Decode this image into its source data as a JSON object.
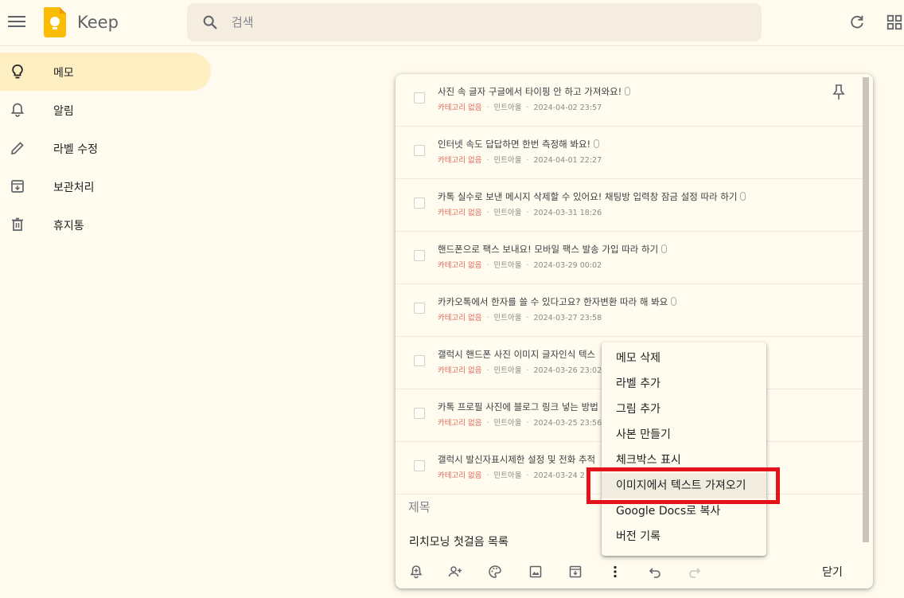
{
  "header": {
    "app_title": "Keep",
    "search_placeholder": "검색"
  },
  "sidebar": {
    "items": [
      {
        "label": "메모",
        "icon": "lightbulb-icon",
        "active": true
      },
      {
        "label": "알림",
        "icon": "bell-icon",
        "active": false
      },
      {
        "label": "라벨 수정",
        "icon": "pencil-icon",
        "active": false
      },
      {
        "label": "보관처리",
        "icon": "archive-icon",
        "active": false
      },
      {
        "label": "휴지통",
        "icon": "trash-icon",
        "active": false
      }
    ]
  },
  "note": {
    "items": [
      {
        "title": "사진 속 글자 구글에서 타이핑 안 하고 가져와요!",
        "category": "카테고리 없음",
        "author": "민트아울",
        "date": "2024-04-02 23:57"
      },
      {
        "title": "인터넷 속도 답답하면 한번 측정해 봐요!",
        "category": "카테고리 없음",
        "author": "민트아울",
        "date": "2024-04-01 22:27"
      },
      {
        "title": "카톡 실수로 보낸 메시지 삭제할 수 있어요! 채팅방 입력창 잠금 설정 따라 하기",
        "category": "카테고리 없음",
        "author": "민트아울",
        "date": "2024-03-31 18:26"
      },
      {
        "title": "핸드폰으로 팩스 보내요! 모바일 팩스 발송 가입 따라 하기",
        "category": "카테고리 없음",
        "author": "민트아울",
        "date": "2024-03-29 00:02"
      },
      {
        "title": "카카오톡에서 한자를 쓸 수 있다고요? 한자변환 따라 해 봐요",
        "category": "카테고리 없음",
        "author": "민트아울",
        "date": "2024-03-27 23:58"
      },
      {
        "title": "갤럭시 핸드폰 사진 이미지 글자인식 텍스",
        "category": "카테고리 없음",
        "author": "민트아울",
        "date": "2024-03-26 23:02"
      },
      {
        "title": "카톡 프로필 사진에 블로그 링크 넣는 방법",
        "category": "카테고리 없음",
        "author": "민트아울",
        "date": "2024-03-25 23:56"
      },
      {
        "title": "갤럭시 발신자표시제한 설정 및 전화 추적",
        "category": "카테고리 없음",
        "author": "민트아울",
        "date": "2024-03-24 2"
      }
    ],
    "title_placeholder": "제목",
    "body": "리치모닝 첫걸음 목록",
    "close_label": "닫기"
  },
  "context_menu": {
    "items": [
      {
        "label": "메모 삭제"
      },
      {
        "label": "라벨 추가"
      },
      {
        "label": "그림 추가"
      },
      {
        "label": "사본 만들기"
      },
      {
        "label": "체크박스 표시"
      },
      {
        "label": "이미지에서 텍스트 가져오기",
        "highlighted": true
      },
      {
        "label": "Google Docs로 복사"
      },
      {
        "label": "버전 기록"
      }
    ]
  },
  "colors": {
    "background": "#fffbee",
    "active_nav": "#feefc3",
    "category_text": "#e06a5a",
    "highlight_border": "#e3131b",
    "logo": "#fbbc04"
  }
}
